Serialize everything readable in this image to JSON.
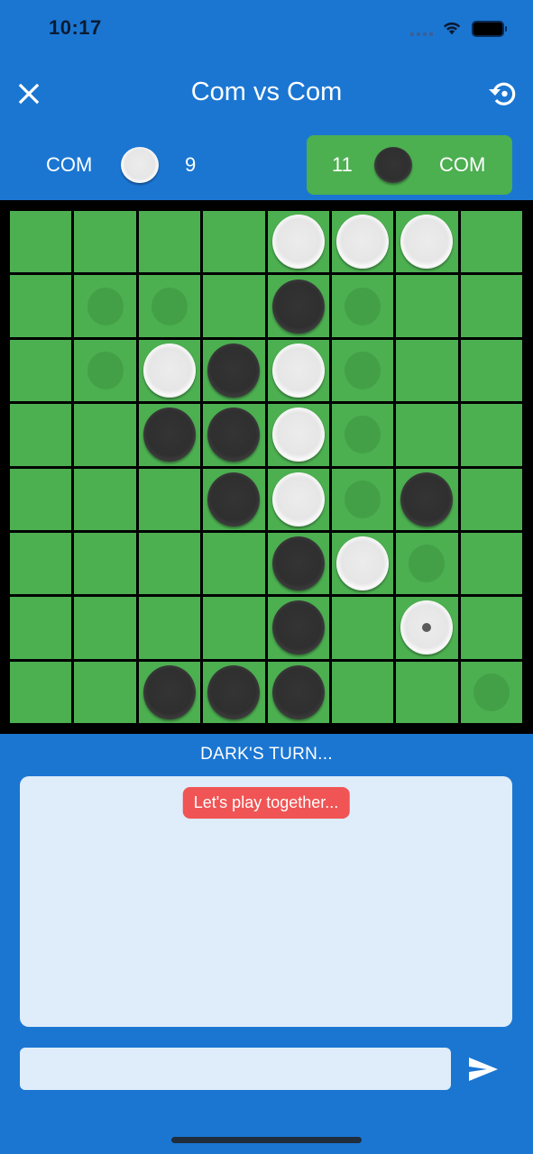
{
  "status_bar": {
    "time": "10:17",
    "wifi_icon": "wifi-icon",
    "battery_icon": "battery-icon",
    "signal_icon": "cellular-signal-icon"
  },
  "app_bar": {
    "title": "Com vs Com",
    "close_icon": "close-icon",
    "reset_icon": "restart-icon"
  },
  "players": {
    "light": {
      "name": "COM",
      "count": "9",
      "color": "white",
      "active": false
    },
    "dark": {
      "name": "COM",
      "count": "11",
      "color": "black",
      "active": true
    }
  },
  "colors": {
    "primary": "#1b76d2",
    "board_green": "#4caf50",
    "hint_green": "#43a047",
    "active_player_bg": "#4caf50",
    "chat_bg": "#dfecf9",
    "bubble_red": "#f05454"
  },
  "board": {
    "size": 8,
    "cells": [
      [
        "",
        "",
        "",
        "",
        "W",
        "W",
        "W",
        ""
      ],
      [
        "",
        "h",
        "h",
        "",
        "B",
        "h",
        "",
        ""
      ],
      [
        "",
        "h",
        "W",
        "B",
        "W",
        "h",
        "",
        ""
      ],
      [
        "",
        "",
        "B",
        "B",
        "W",
        "h",
        "",
        ""
      ],
      [
        "",
        "",
        "",
        "B",
        "W",
        "h",
        "B",
        ""
      ],
      [
        "",
        "",
        "",
        "",
        "B",
        "W",
        "h",
        ""
      ],
      [
        "",
        "",
        "",
        "",
        "B",
        "",
        "W*",
        ""
      ],
      [
        "",
        "",
        "B",
        "B",
        "B",
        "",
        "",
        "h"
      ]
    ],
    "legend": {
      "W": "white disc",
      "B": "black disc",
      "h": "valid move hint",
      "W*": "white disc, last move"
    }
  },
  "turn_label": "DARK'S TURN...",
  "chat": {
    "messages": [
      {
        "text": "Let's play together...",
        "style": "system"
      }
    ]
  },
  "input": {
    "value": "",
    "placeholder": "",
    "send_icon": "send-icon"
  }
}
